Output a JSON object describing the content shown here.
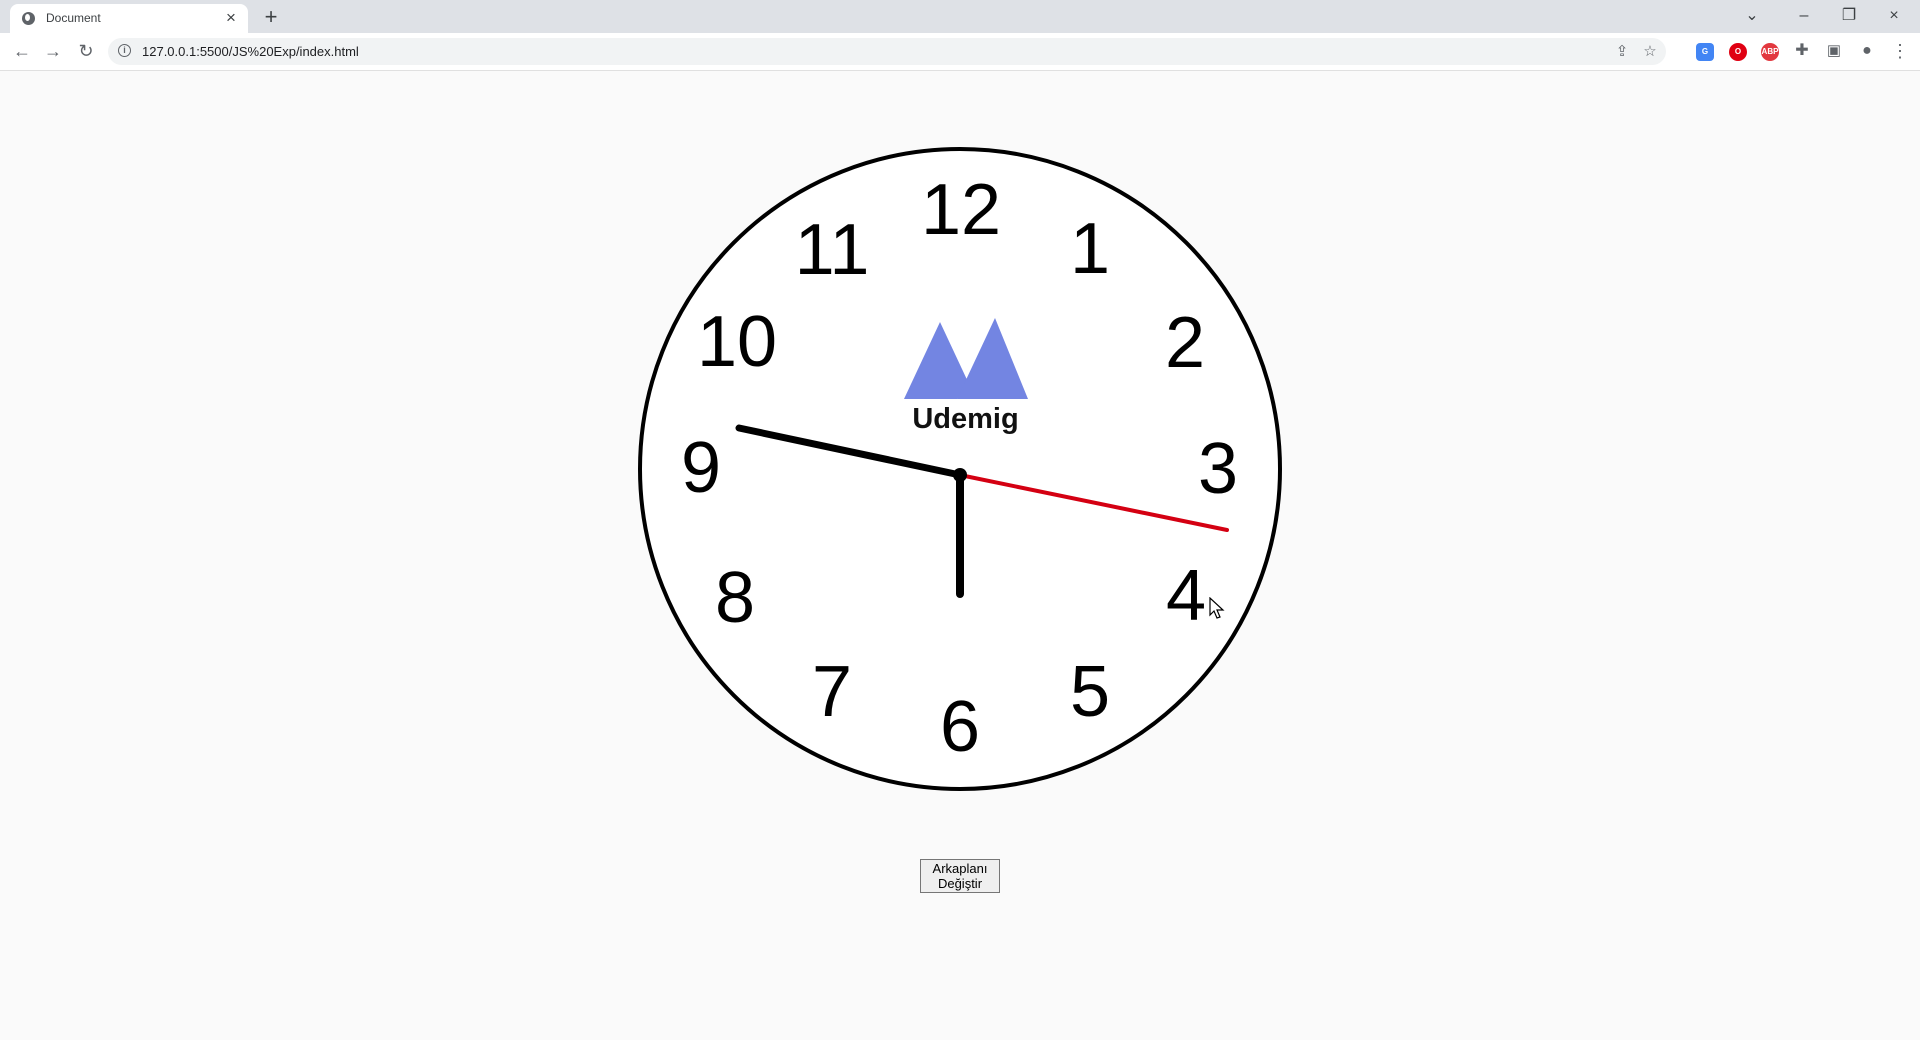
{
  "browser": {
    "tab": {
      "title": "Document",
      "close_icon": "close-icon"
    },
    "new_tab_icon": "plus-icon",
    "window_controls": {
      "tab_search_icon": "chevron-down-icon",
      "minimize_icon": "minimize-icon",
      "restore_icon": "restore-icon",
      "close_icon": "close-icon"
    },
    "navigation": {
      "back_icon": "back-arrow-icon",
      "forward_icon": "forward-arrow-icon",
      "reload_icon": "reload-icon"
    },
    "address_bar": {
      "url": "127.0.0.1:5500/JS%20Exp/index.html",
      "site_info_icon": "info-icon",
      "share_icon": "share-icon",
      "bookmark_icon": "star-icon"
    },
    "extensions": [
      {
        "name": "translate-extension-icon",
        "label": "G"
      },
      {
        "name": "opera-extension-icon",
        "label": "O"
      },
      {
        "name": "adblock-extension-icon",
        "label": "ABP"
      }
    ],
    "toolbar_icons": {
      "puzzle_icon": "puzzle-icon",
      "side_panel_icon": "side-panel-icon",
      "profile_icon": "profile-icon",
      "menu_icon": "more-vertical-icon"
    }
  },
  "clock": {
    "numbers": [
      "12",
      "1",
      "2",
      "3",
      "4",
      "5",
      "6",
      "7",
      "8",
      "9",
      "10",
      "11"
    ],
    "logo": {
      "text": "Udemig",
      "shape_color": "#7385e2"
    },
    "hands": {
      "hour_time": "6:00",
      "minute_time": "48.3 minutes",
      "second_time": "16.8 seconds",
      "hour_color": "#000000",
      "minute_color": "#000000",
      "second_color": "#d40012"
    }
  },
  "controls": {
    "change_background_button": "Arkaplanı Değiştir"
  },
  "colors": {
    "page_background": "#fafafa",
    "clock_face": "#ffffff",
    "clock_border": "#000000",
    "browser_tabstrip": "#dee1e6"
  }
}
